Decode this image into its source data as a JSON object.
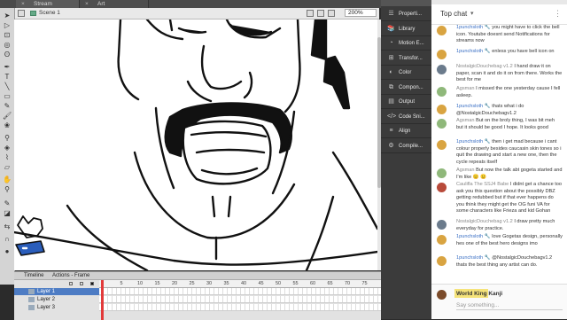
{
  "flash": {
    "doc_tabs": [
      "Stream Doodles.fla*",
      "Art Commissions.fla"
    ],
    "scene_label": "Scene 1",
    "zoom": "200%",
    "timeline_tabs": [
      "Timeline",
      "Actions - Frame"
    ],
    "ruler_numbers": [
      "1",
      "5",
      "10",
      "15",
      "20",
      "25",
      "30",
      "35",
      "40",
      "45",
      "50",
      "55",
      "60",
      "65",
      "70",
      "75"
    ],
    "layers": [
      "Layer 1",
      "Layer 2",
      "Layer 3"
    ],
    "panels": [
      "Properti...",
      "Library",
      "Motion E...",
      "Transfor...",
      "Color",
      "Compon...",
      "Output",
      "Code Sni...",
      "Align",
      "Compile..."
    ]
  },
  "chat": {
    "title": "Top chat",
    "caret": "▾",
    "more": "⋮",
    "messages": [
      {
        "author": "1punchsloth",
        "mod": true,
        "text": "you might have to click the bell icon. Youtube doesnt send Notifications for streams now",
        "avatar_color": "#d9a441"
      },
      {
        "author": "1punchsloth",
        "mod": true,
        "text": "enless you have bell icon on",
        "avatar_color": "#d9a441"
      },
      {
        "author": "NostalgicDouchebag v1.2",
        "mod": false,
        "text": "I hand draw it on paper, scan it and do it on from there. Works the best for me",
        "avatar_color": "#6b7b8c"
      },
      {
        "author": "Agsman",
        "mod": false,
        "text": "I missed the one yesterday cause I fell asleep.",
        "avatar_color": "#8fb87a"
      },
      {
        "author": "1punchsloth",
        "mod": true,
        "text": "thats what i do @NostalgicDouchebagv1.2",
        "avatar_color": "#d9a441"
      },
      {
        "author": "Agsman",
        "mod": false,
        "text": "But on the broly thing, I was bit meh but it should be good I hope. It looks good",
        "avatar_color": "#8fb87a"
      },
      {
        "author": "1punchsloth",
        "mod": true,
        "text": "then i get mad because i cant colour properly besides caucasin skin tones so i quit the drawing and start a new one, then the cycle repeats itself",
        "avatar_color": "#d9a441"
      },
      {
        "author": "Agsman",
        "mod": false,
        "text": "But now the talk abt gogeta started and I'm like 😐 😐",
        "avatar_color": "#8fb87a"
      },
      {
        "author": "Caulifla The SSJ4 Babe",
        "mod": false,
        "text": "I didnt get a chance too ask you this question about the possibly DBZ getting redubbed but if that ever happens do you think they might get the OG funi VA for some characters like Frieza and kid Gohan",
        "avatar_color": "#b84a3a"
      },
      {
        "author": "NostalgicDouchebag v1.2",
        "mod": false,
        "text": "I draw pretty much everyday for practice.",
        "avatar_color": "#6b7b8c"
      },
      {
        "author": "1punchsloth",
        "mod": true,
        "text": "love Gogetas design, personally hes one of the best hero designs imo",
        "avatar_color": "#d9a441"
      },
      {
        "author": "1punchsloth",
        "mod": true,
        "text": "@NostalgicDouchebagv1.2 thats the best thing any artist can do.",
        "avatar_color": "#d9a441"
      }
    ],
    "input_user": "World King Kanji",
    "input_placeholder": "Say something..."
  },
  "colors": {
    "mod_blue": "#3a6fc4",
    "selected_layer": "#4d7cc4",
    "playhead": "#e23a3a",
    "username_highlight": "#f5e37a"
  }
}
